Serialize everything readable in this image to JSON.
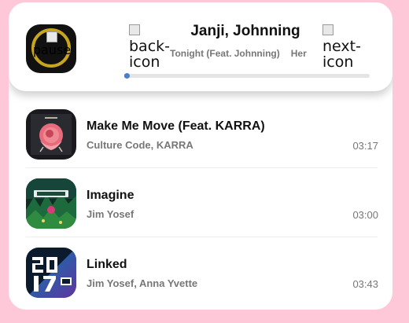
{
  "now_playing": {
    "cover_alt": "pause",
    "artist": "Janji, Johnning",
    "marquee_title": "Tonight (Feat. Johnning)",
    "marquee_next": "Her",
    "back_alt": "back-icon",
    "next_alt": "next-icon",
    "progress_fraction": 0.01
  },
  "tracks": [
    {
      "title": "Make Me Move (Feat. KARRA)",
      "artist": "Culture Code, KARRA",
      "duration": "03:17",
      "art_icon": "rose-album-art"
    },
    {
      "title": "Imagine",
      "artist": "Jim Yosef",
      "duration": "03:00",
      "art_icon": "forest-album-art"
    },
    {
      "title": "Linked",
      "artist": "Jim Yosef, Anna Yvette",
      "duration": "03:43",
      "art_icon": "2017-album-art"
    }
  ],
  "colors": {
    "page_background": "#ffc8d9",
    "card_background": "#ffffff",
    "progress_accent": "#4d7fc7",
    "muted_text": "#777777"
  }
}
